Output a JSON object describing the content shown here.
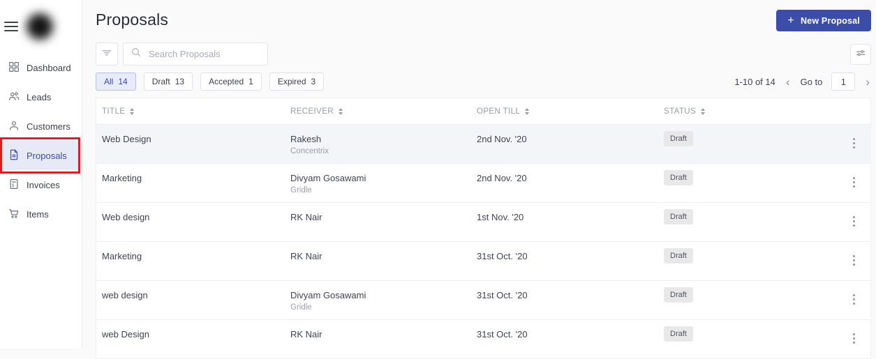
{
  "sidebar": {
    "items": [
      {
        "label": "Dashboard",
        "active": false
      },
      {
        "label": "Leads",
        "active": false
      },
      {
        "label": "Customers",
        "active": false
      },
      {
        "label": "Proposals",
        "active": true,
        "annotated": true
      },
      {
        "label": "Invoices",
        "active": false
      },
      {
        "label": "Items",
        "active": false
      }
    ]
  },
  "header": {
    "title": "Proposals",
    "new_button": {
      "plus": "+",
      "label": "New Proposal"
    }
  },
  "toolbar": {
    "search_placeholder": "Search Proposals"
  },
  "tabs": [
    {
      "label": "All",
      "count": "14",
      "active": true
    },
    {
      "label": "Draft",
      "count": "13",
      "active": false
    },
    {
      "label": "Accepted",
      "count": "1",
      "active": false
    },
    {
      "label": "Expired",
      "count": "3",
      "active": false
    }
  ],
  "pagination": {
    "range": "1-10 of 14",
    "prev": "‹",
    "goto_label": "Go to",
    "page_value": "1",
    "next": "›"
  },
  "table": {
    "columns": [
      "TITLE",
      "RECEIVER",
      "OPEN TILL",
      "STATUS"
    ],
    "rows": [
      {
        "title": "Web Design",
        "receiver": "Rakesh",
        "company": "Concentrix",
        "open_till": "2nd Nov. '20",
        "status": "Draft",
        "highlight": true
      },
      {
        "title": "Marketing",
        "receiver": "Divyam Gosawami",
        "company": "Gridle",
        "open_till": "2nd Nov. '20",
        "status": "Draft",
        "highlight": false
      },
      {
        "title": "Web design",
        "receiver": "RK Nair",
        "company": "",
        "open_till": "1st Nov. '20",
        "status": "Draft",
        "highlight": false
      },
      {
        "title": "Marketing",
        "receiver": "RK Nair",
        "company": "",
        "open_till": "31st Oct. '20",
        "status": "Draft",
        "highlight": false
      },
      {
        "title": "web design",
        "receiver": "Divyam Gosawami",
        "company": "Gridle",
        "open_till": "31st Oct. '20",
        "status": "Draft",
        "highlight": false
      },
      {
        "title": "web Design",
        "receiver": "RK Nair",
        "company": "",
        "open_till": "31st Oct. '20",
        "status": "Draft",
        "highlight": false
      }
    ]
  },
  "colors": {
    "accent_indigo": "#3c4da9",
    "annotation_red": "#e01b22",
    "active_tab_bg": "#e8ebf8",
    "badge_bg": "#e8e8e9",
    "row_highlight": "#f3f5f8",
    "main_bg": "#fafafb"
  }
}
